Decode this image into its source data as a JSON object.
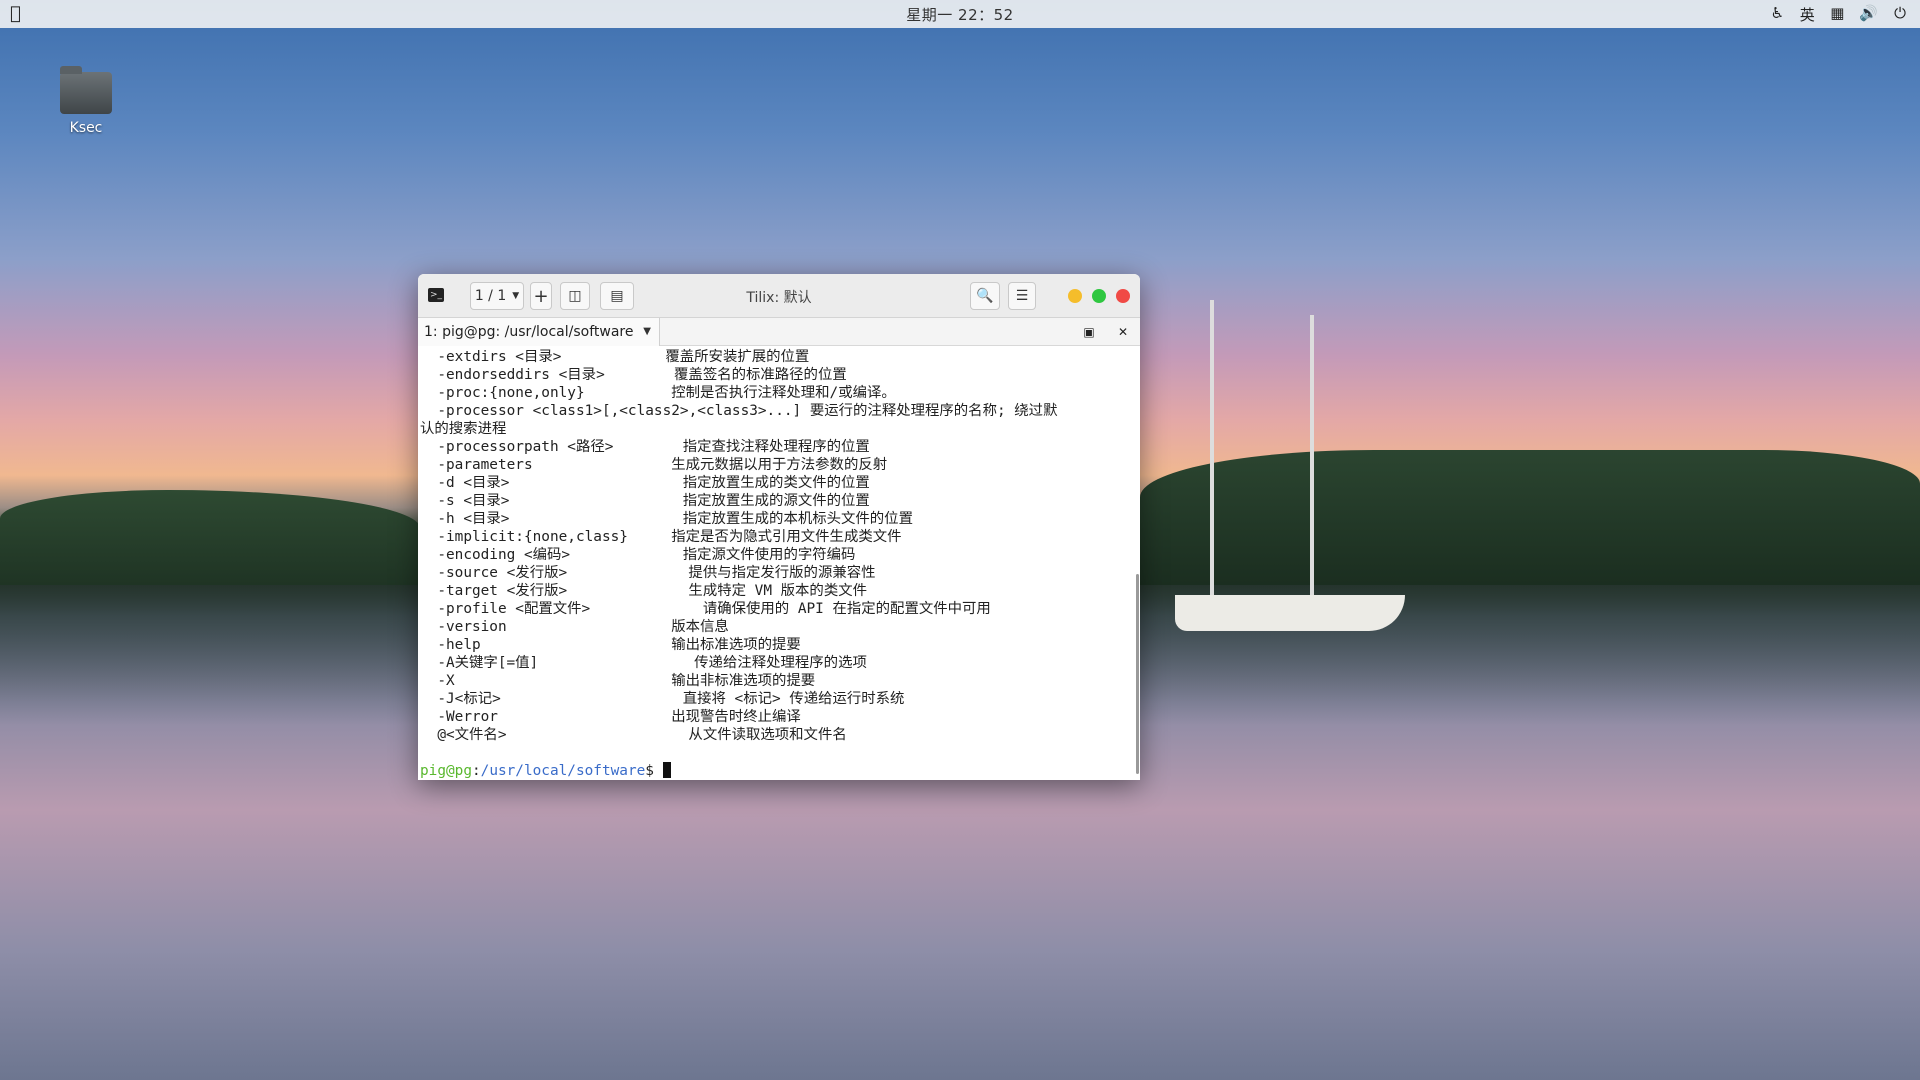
{
  "topbar": {
    "apple_icon": "apple-logo-icon",
    "clock": "星期一 22：52",
    "tray": {
      "accessibility_icon": "accessibility-icon",
      "input_method": "英",
      "network_icon": "network-icon",
      "volume_icon": "volume-icon",
      "power_icon": "power-icon"
    }
  },
  "desktop": {
    "icons": [
      {
        "label": "Ksec",
        "icon": "folder-icon"
      }
    ]
  },
  "window": {
    "title": "Tilix: 默认",
    "session_counter": "1 / 1",
    "tab_label": "1: pig@pg: /usr/local/software",
    "colors": {
      "prompt_user": "#59b82e",
      "prompt_path": "#3a6cc9",
      "close": "#f04a45",
      "minimize": "#f5bd2b",
      "maximize": "#2fc740"
    }
  },
  "terminal": {
    "lines": [
      "  -extdirs <目录>            覆盖所安装扩展的位置",
      "  -endorseddirs <目录>        覆盖签名的标准路径的位置",
      "  -proc:{none,only}          控制是否执行注释处理和/或编译。",
      "  -processor <class1>[,<class2>,<class3>...] 要运行的注释处理程序的名称; 绕过默",
      "认的搜索进程",
      "  -processorpath <路径>        指定查找注释处理程序的位置",
      "  -parameters                生成元数据以用于方法参数的反射",
      "  -d <目录>                    指定放置生成的类文件的位置",
      "  -s <目录>                    指定放置生成的源文件的位置",
      "  -h <目录>                    指定放置生成的本机标头文件的位置",
      "  -implicit:{none,class}     指定是否为隐式引用文件生成类文件",
      "  -encoding <编码>             指定源文件使用的字符编码",
      "  -source <发行版>              提供与指定发行版的源兼容性",
      "  -target <发行版>              生成特定 VM 版本的类文件",
      "  -profile <配置文件>             请确保使用的 API 在指定的配置文件中可用",
      "  -version                   版本信息",
      "  -help                      输出标准选项的提要",
      "  -A关键字[=值]                  传递给注释处理程序的选项",
      "  -X                         输出非标准选项的提要",
      "  -J<标记>                     直接将 <标记> 传递给运行时系统",
      "  -Werror                    出现警告时终止编译",
      "  @<文件名>                     从文件读取选项和文件名",
      ""
    ],
    "prompt_user": "pig@pg",
    "prompt_sep": ":",
    "prompt_path": "/usr/local/software",
    "prompt_end": "$ "
  }
}
